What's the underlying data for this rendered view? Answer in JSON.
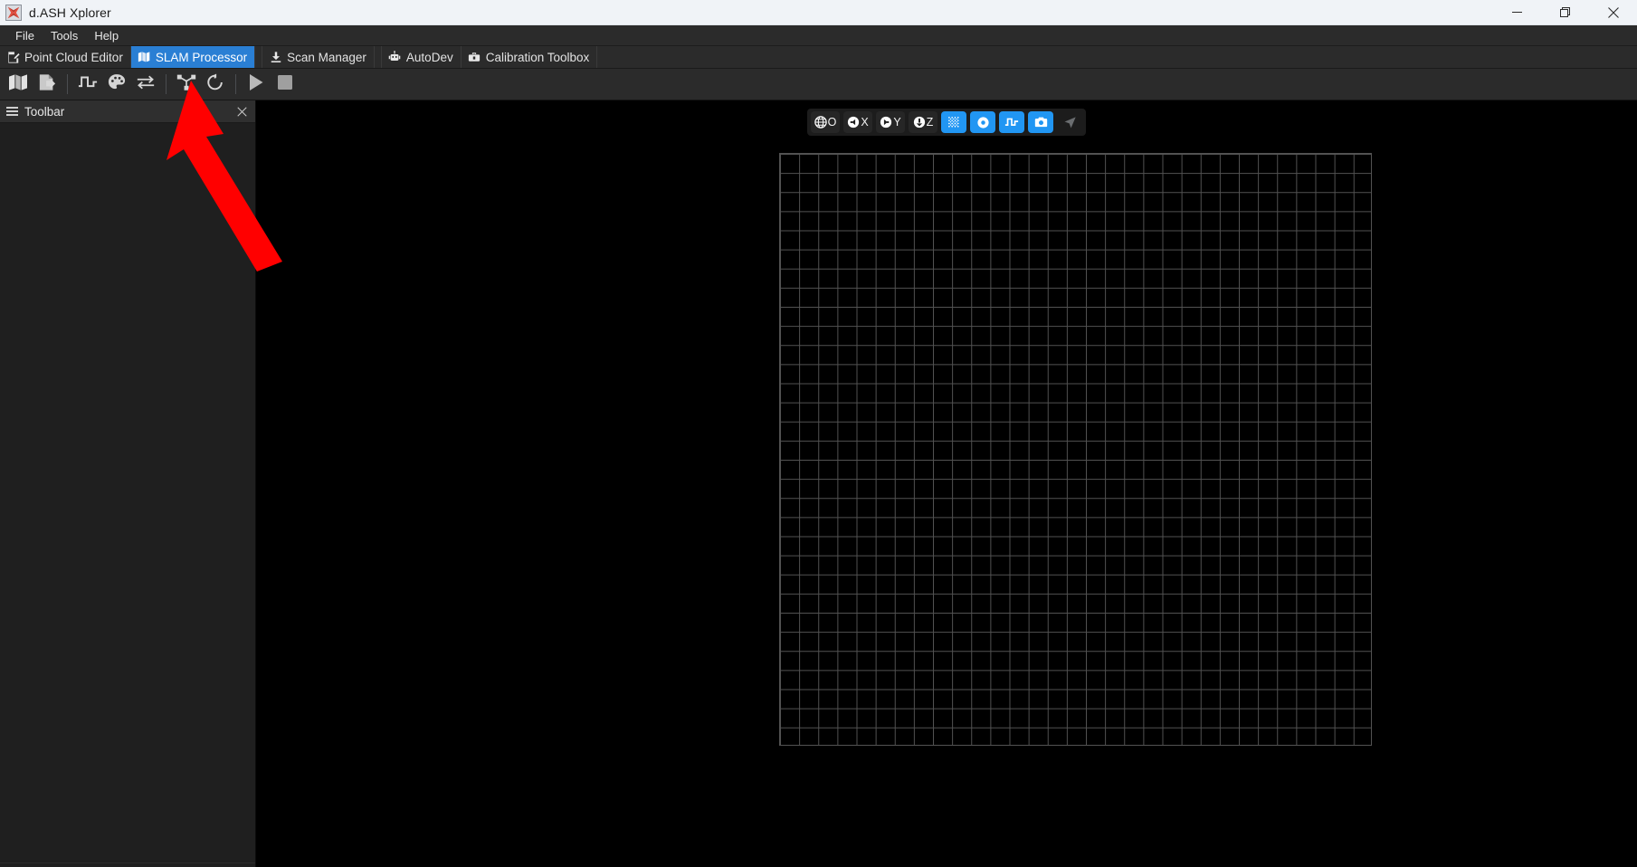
{
  "window": {
    "title": "d.ASH Xplorer",
    "app_icon": "app-logo-icon",
    "controls": {
      "minimize": "—",
      "restore": "❐",
      "close": "✕"
    }
  },
  "menubar": {
    "items": [
      {
        "label": "File"
      },
      {
        "label": "Tools"
      },
      {
        "label": "Help"
      }
    ]
  },
  "tabs": {
    "items": [
      {
        "label": "Point Cloud Editor",
        "icon": "edit-document-icon",
        "active": false
      },
      {
        "label": "SLAM Processor",
        "icon": "map-book-icon",
        "active": true
      },
      {
        "label": "Scan Manager",
        "icon": "download-icon",
        "active": false
      },
      {
        "label": "AutoDev",
        "icon": "robot-icon",
        "active": false
      },
      {
        "label": "Calibration Toolbox",
        "icon": "toolbox-icon",
        "active": false
      }
    ]
  },
  "toolbar": {
    "buttons": [
      {
        "name": "open-map-icon",
        "tooltip": "Open Map"
      },
      {
        "name": "export-file-icon",
        "tooltip": "Export"
      },
      {
        "name": "square-wave-icon",
        "tooltip": "Signal"
      },
      {
        "name": "palette-icon",
        "tooltip": "Color"
      },
      {
        "name": "swap-arrows-icon",
        "tooltip": "Swap"
      },
      {
        "name": "node-graph-icon",
        "tooltip": "Graph"
      },
      {
        "name": "loop-arrow-icon",
        "tooltip": "Loop Closure"
      },
      {
        "name": "play-icon",
        "tooltip": "Run"
      },
      {
        "name": "stop-icon",
        "tooltip": "Stop"
      }
    ],
    "separator_after": [
      1,
      4,
      6
    ]
  },
  "dock": {
    "title": "Toolbar",
    "grip_icon": "hamburger-grip-icon",
    "close_icon": "close-icon"
  },
  "viewport": {
    "toolbar": [
      {
        "name": "view-origin-button",
        "icon": "globe-icon",
        "label": "O",
        "active": false
      },
      {
        "name": "view-x-button",
        "icon": "arrow-left-icon",
        "label": "X",
        "active": false
      },
      {
        "name": "view-y-button",
        "icon": "arrow-right-icon",
        "label": "Y",
        "active": false
      },
      {
        "name": "view-z-button",
        "icon": "arrow-down-icon",
        "label": "Z",
        "active": false
      },
      {
        "name": "toggle-grid-button",
        "icon": "dot-grid-icon",
        "label": "",
        "active": true
      },
      {
        "name": "toggle-points-button",
        "icon": "circle-dot-icon",
        "label": "",
        "active": true
      },
      {
        "name": "toggle-signal-button",
        "icon": "square-wave-icon",
        "label": "",
        "active": true
      },
      {
        "name": "screenshot-button",
        "icon": "camera-icon",
        "label": "",
        "active": true
      },
      {
        "name": "navigate-button",
        "icon": "navigation-arrow-icon",
        "label": "",
        "active": false
      }
    ],
    "grid": {
      "columns": 31,
      "rows": 31,
      "line_color": "#525252",
      "background": "#000000"
    }
  },
  "annotation": {
    "type": "arrow",
    "color": "#ff0000",
    "points_to": "slam-processor-toolbar-button"
  },
  "colors": {
    "accent": "#2a7fd4",
    "viewport_active": "#2196f3",
    "titlebar_bg": "#f0f3f7",
    "chrome_bg": "#2b2b2b",
    "panel_bg": "#1f1f1f"
  }
}
